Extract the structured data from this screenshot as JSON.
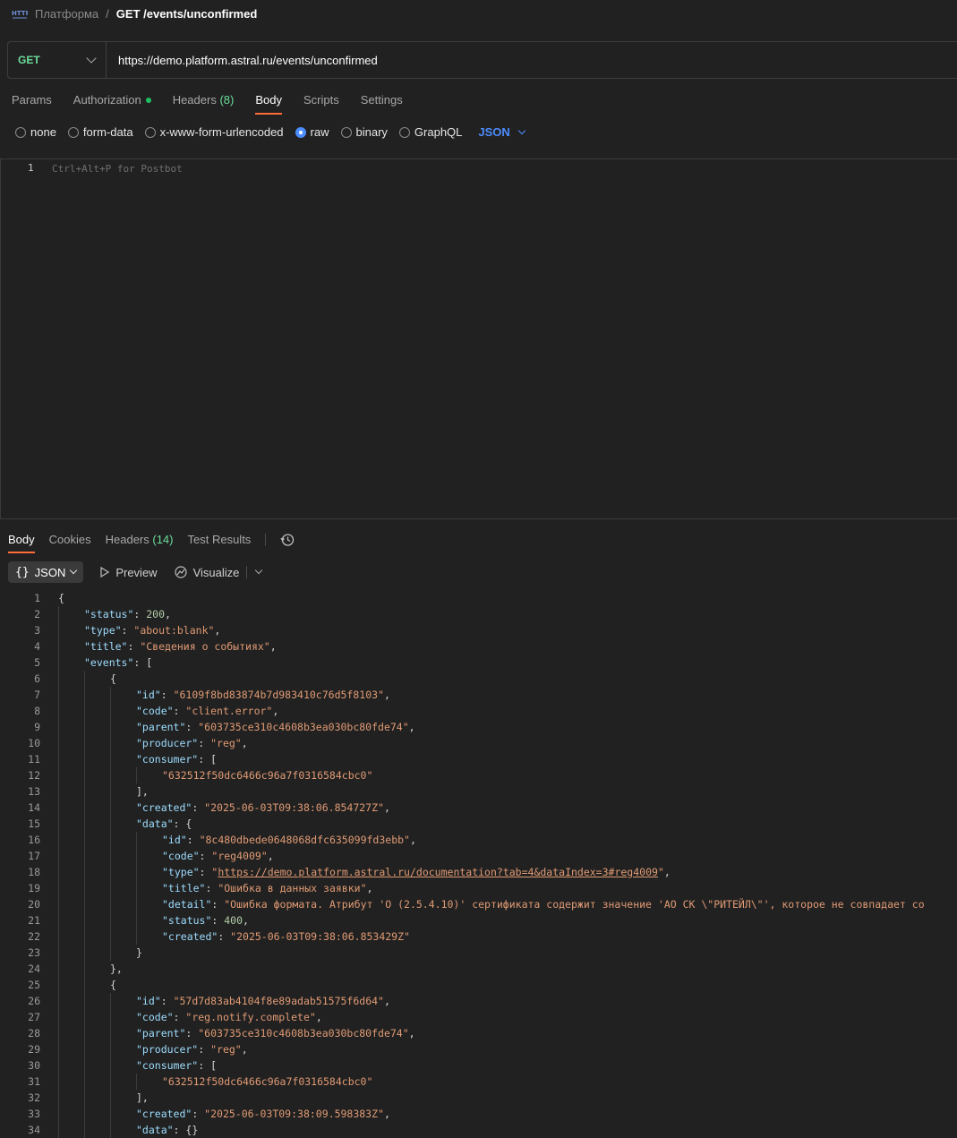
{
  "breadcrumb": {
    "icon": "http-icon",
    "collection": "Платформа",
    "separator": "/",
    "request_name": "GET /events/unconfirmed"
  },
  "request": {
    "method": "GET",
    "url": "https://demo.platform.astral.ru/events/unconfirmed",
    "tabs": [
      {
        "label": "Params"
      },
      {
        "label": "Authorization"
      },
      {
        "label": "Headers",
        "count": "(8)"
      },
      {
        "label": "Body"
      },
      {
        "label": "Scripts"
      },
      {
        "label": "Settings"
      }
    ],
    "active_tab": "Body",
    "body_types": [
      "none",
      "form-data",
      "x-www-form-urlencoded",
      "raw",
      "binary",
      "GraphQL"
    ],
    "selected_body_type": "raw",
    "language": "JSON",
    "editor": {
      "line_number": "1",
      "placeholder": "Ctrl+Alt+P for Postbot"
    }
  },
  "response": {
    "tabs": [
      {
        "label": "Body"
      },
      {
        "label": "Cookies"
      },
      {
        "label": "Headers",
        "count": "(14)"
      },
      {
        "label": "Test Results"
      }
    ],
    "active_tab": "Body",
    "format": "JSON",
    "preview_label": "Preview",
    "visualize_label": "Visualize",
    "code_lines": [
      {
        "n": "1",
        "i": 0,
        "t": [
          [
            "p",
            "{"
          ]
        ]
      },
      {
        "n": "2",
        "i": 1,
        "t": [
          [
            "k",
            "\"status\""
          ],
          [
            "p",
            ": "
          ],
          [
            "n",
            "200"
          ],
          [
            "p",
            ","
          ]
        ]
      },
      {
        "n": "3",
        "i": 1,
        "t": [
          [
            "k",
            "\"type\""
          ],
          [
            "p",
            ": "
          ],
          [
            "s",
            "\"about:blank\""
          ],
          [
            "p",
            ","
          ]
        ]
      },
      {
        "n": "4",
        "i": 1,
        "t": [
          [
            "k",
            "\"title\""
          ],
          [
            "p",
            ": "
          ],
          [
            "s",
            "\"Сведения о событиях\""
          ],
          [
            "p",
            ","
          ]
        ]
      },
      {
        "n": "5",
        "i": 1,
        "t": [
          [
            "k",
            "\"events\""
          ],
          [
            "p",
            ": ["
          ]
        ]
      },
      {
        "n": "6",
        "i": 2,
        "t": [
          [
            "p",
            "{"
          ]
        ]
      },
      {
        "n": "7",
        "i": 3,
        "t": [
          [
            "k",
            "\"id\""
          ],
          [
            "p",
            ": "
          ],
          [
            "s",
            "\"6109f8bd83874b7d983410c76d5f8103\""
          ],
          [
            "p",
            ","
          ]
        ]
      },
      {
        "n": "8",
        "i": 3,
        "t": [
          [
            "k",
            "\"code\""
          ],
          [
            "p",
            ": "
          ],
          [
            "s",
            "\"client.error\""
          ],
          [
            "p",
            ","
          ]
        ]
      },
      {
        "n": "9",
        "i": 3,
        "t": [
          [
            "k",
            "\"parent\""
          ],
          [
            "p",
            ": "
          ],
          [
            "s",
            "\"603735ce310c4608b3ea030bc80fde74\""
          ],
          [
            "p",
            ","
          ]
        ]
      },
      {
        "n": "10",
        "i": 3,
        "t": [
          [
            "k",
            "\"producer\""
          ],
          [
            "p",
            ": "
          ],
          [
            "s",
            "\"reg\""
          ],
          [
            "p",
            ","
          ]
        ]
      },
      {
        "n": "11",
        "i": 3,
        "t": [
          [
            "k",
            "\"consumer\""
          ],
          [
            "p",
            ": ["
          ]
        ]
      },
      {
        "n": "12",
        "i": 4,
        "t": [
          [
            "s",
            "\"632512f50dc6466c96a7f0316584cbc0\""
          ]
        ]
      },
      {
        "n": "13",
        "i": 3,
        "t": [
          [
            "p",
            "],"
          ]
        ]
      },
      {
        "n": "14",
        "i": 3,
        "t": [
          [
            "k",
            "\"created\""
          ],
          [
            "p",
            ": "
          ],
          [
            "s",
            "\"2025-06-03T09:38:06.854727Z\""
          ],
          [
            "p",
            ","
          ]
        ]
      },
      {
        "n": "15",
        "i": 3,
        "t": [
          [
            "k",
            "\"data\""
          ],
          [
            "p",
            ": {"
          ]
        ]
      },
      {
        "n": "16",
        "i": 4,
        "t": [
          [
            "k",
            "\"id\""
          ],
          [
            "p",
            ": "
          ],
          [
            "s",
            "\"8c480dbede0648068dfc635099fd3ebb\""
          ],
          [
            "p",
            ","
          ]
        ]
      },
      {
        "n": "17",
        "i": 4,
        "t": [
          [
            "k",
            "\"code\""
          ],
          [
            "p",
            ": "
          ],
          [
            "s",
            "\"reg4009\""
          ],
          [
            "p",
            ","
          ]
        ]
      },
      {
        "n": "18",
        "i": 4,
        "t": [
          [
            "k",
            "\"type\""
          ],
          [
            "p",
            ": "
          ],
          [
            "s",
            "\""
          ],
          [
            "u",
            "https://demo.platform.astral.ru/documentation?tab=4&dataIndex=3#reg4009"
          ],
          [
            "s",
            "\""
          ],
          [
            "p",
            ","
          ]
        ]
      },
      {
        "n": "19",
        "i": 4,
        "t": [
          [
            "k",
            "\"title\""
          ],
          [
            "p",
            ": "
          ],
          [
            "s",
            "\"Ошибка в данных заявки\""
          ],
          [
            "p",
            ","
          ]
        ]
      },
      {
        "n": "20",
        "i": 4,
        "t": [
          [
            "k",
            "\"detail\""
          ],
          [
            "p",
            ": "
          ],
          [
            "s",
            "\"Ошибка формата. Атрибут 'O (2.5.4.10)' сертификата содержит значение 'АО СК \\\"РИТЕЙЛ\\\"', которое не совпадает со"
          ]
        ]
      },
      {
        "n": "21",
        "i": 4,
        "t": [
          [
            "k",
            "\"status\""
          ],
          [
            "p",
            ": "
          ],
          [
            "n",
            "400"
          ],
          [
            "p",
            ","
          ]
        ]
      },
      {
        "n": "22",
        "i": 4,
        "t": [
          [
            "k",
            "\"created\""
          ],
          [
            "p",
            ": "
          ],
          [
            "s",
            "\"2025-06-03T09:38:06.853429Z\""
          ]
        ]
      },
      {
        "n": "23",
        "i": 3,
        "t": [
          [
            "p",
            "}"
          ]
        ]
      },
      {
        "n": "24",
        "i": 2,
        "t": [
          [
            "p",
            "},"
          ]
        ]
      },
      {
        "n": "25",
        "i": 2,
        "t": [
          [
            "p",
            "{"
          ]
        ]
      },
      {
        "n": "26",
        "i": 3,
        "t": [
          [
            "k",
            "\"id\""
          ],
          [
            "p",
            ": "
          ],
          [
            "s",
            "\"57d7d83ab4104f8e89adab51575f6d64\""
          ],
          [
            "p",
            ","
          ]
        ]
      },
      {
        "n": "27",
        "i": 3,
        "t": [
          [
            "k",
            "\"code\""
          ],
          [
            "p",
            ": "
          ],
          [
            "s",
            "\"reg.notify.complete\""
          ],
          [
            "p",
            ","
          ]
        ]
      },
      {
        "n": "28",
        "i": 3,
        "t": [
          [
            "k",
            "\"parent\""
          ],
          [
            "p",
            ": "
          ],
          [
            "s",
            "\"603735ce310c4608b3ea030bc80fde74\""
          ],
          [
            "p",
            ","
          ]
        ]
      },
      {
        "n": "29",
        "i": 3,
        "t": [
          [
            "k",
            "\"producer\""
          ],
          [
            "p",
            ": "
          ],
          [
            "s",
            "\"reg\""
          ],
          [
            "p",
            ","
          ]
        ]
      },
      {
        "n": "30",
        "i": 3,
        "t": [
          [
            "k",
            "\"consumer\""
          ],
          [
            "p",
            ": ["
          ]
        ]
      },
      {
        "n": "31",
        "i": 4,
        "t": [
          [
            "s",
            "\"632512f50dc6466c96a7f0316584cbc0\""
          ]
        ]
      },
      {
        "n": "32",
        "i": 3,
        "t": [
          [
            "p",
            "],"
          ]
        ]
      },
      {
        "n": "33",
        "i": 3,
        "t": [
          [
            "k",
            "\"created\""
          ],
          [
            "p",
            ": "
          ],
          [
            "s",
            "\"2025-06-03T09:38:09.598383Z\""
          ],
          [
            "p",
            ","
          ]
        ]
      },
      {
        "n": "34",
        "i": 3,
        "t": [
          [
            "k",
            "\"data\""
          ],
          [
            "p",
            ": {}"
          ]
        ]
      }
    ]
  },
  "colors": {
    "method_get": "#6bdd9a",
    "accent_active_tab": "#ff6c37",
    "auth_status_dot": "#1fbf61",
    "json_selector": "#4c8dff",
    "json_key": "#9cdcfe",
    "json_string": "#e09a74",
    "json_number": "#b5cea8"
  },
  "icons": [
    "http-icon",
    "chevron-down-icon",
    "radio-icon",
    "braces-icon",
    "play-icon",
    "visualize-icon",
    "history-icon"
  ]
}
